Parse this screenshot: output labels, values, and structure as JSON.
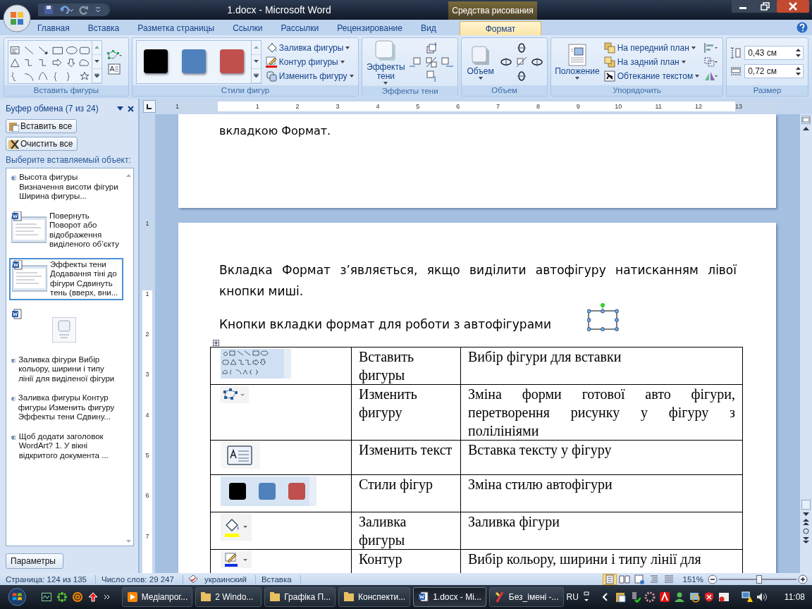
{
  "window": {
    "title": "1.docx - Microsoft Word",
    "context_tab": "Средства рисования"
  },
  "ribbon": {
    "tabs": [
      {
        "label": "Главная",
        "selected": false
      },
      {
        "label": "Вставка",
        "selected": false
      },
      {
        "label": "Разметка страницы",
        "selected": false
      },
      {
        "label": "Ссылки",
        "selected": false
      },
      {
        "label": "Рассылки",
        "selected": false
      },
      {
        "label": "Рецензирование",
        "selected": false
      },
      {
        "label": "Вид",
        "selected": false
      },
      {
        "label": "Формат",
        "selected": true
      }
    ],
    "groups": [
      {
        "kind": "shapes",
        "name": "Вставить фигуры"
      },
      {
        "kind": "styles",
        "name": "Стили фигур",
        "swatches": [
          {
            "color": "#000000"
          },
          {
            "color": "#4f81bd"
          },
          {
            "color": "#c0504d"
          }
        ],
        "commands": [
          "Заливка фигуры",
          "Контур фигуры",
          "Изменить фигуру"
        ]
      },
      {
        "kind": "shadow",
        "name": "Эффекты тени",
        "button": "Эффекты тени"
      },
      {
        "kind": "volume",
        "name": "Объем",
        "button": "Объем"
      },
      {
        "kind": "arrange",
        "name": "Упорядочить",
        "button": "Положение",
        "commands": [
          "На передний план",
          "На задний план",
          "Обтекание текстом"
        ]
      },
      {
        "kind": "size",
        "name": "Размер",
        "fields": [
          {
            "value": "0,43 см"
          },
          {
            "value": "0,72 см"
          }
        ]
      }
    ]
  },
  "clipboard_pane": {
    "title": "Буфер обмена (7 из 24)",
    "buttons": [
      "Вставить все",
      "Очистить все"
    ],
    "prompt": "Выберите вставляемый объект:",
    "items": [
      {
        "kind": "text",
        "text": "Высота фигуры Визначення висоти фігури Ширина фигуры...",
        "selected": false
      },
      {
        "kind": "thumbnail",
        "text": "Повернуть Поворот або відображення виділеного об’єкту",
        "selected": false
      },
      {
        "kind": "thumbnail",
        "text": "Эффекты тени Додавання тіні до фігури Сдвинуть тень (вверх, вни...",
        "selected": true
      },
      {
        "kind": "image",
        "selected": false
      },
      {
        "kind": "text",
        "text": "Заливка фігури Вибір кольору, ширини і типу лінії для виділеної фігури",
        "selected": false
      },
      {
        "kind": "text",
        "text": "Заливка фигуры Контур фигуры Изменить фигуру Эффекты тени Сдвину...",
        "selected": false
      },
      {
        "kind": "text",
        "text": "Щоб додати заголовок WordArt? 1. У вікні відкритого документа ...",
        "selected": false
      }
    ],
    "options_button": "Параметры"
  },
  "rulers": {
    "horizontal": [
      "1",
      "1",
      "2",
      "3",
      "4",
      "5",
      "6",
      "7",
      "8",
      "9",
      "10",
      "11",
      "12",
      "13"
    ],
    "vertical": [
      "1",
      "1",
      "2",
      "3",
      "4",
      "5",
      "6",
      "7"
    ]
  },
  "document": {
    "page_1": {
      "text": "вкладкою Формат."
    },
    "page_2": {
      "paragraphs": [
        "Вкладка Формат з’являється, якщо виділити автофігуру натисканням лівої кнопки миші.",
        "Кнопки вкладки формат для роботи з автофігурами"
      ],
      "table": {
        "rows": [
          {
            "kind": "shapes",
            "name": "Вставить фигуры",
            "description": "Вибір фігури для вставки"
          },
          {
            "kind": "edit_shape",
            "name": "Изменить фигуру",
            "description": "Зміна форми готової авто фігури, перетворення рисунку у фігуру з полілініями"
          },
          {
            "kind": "text_box",
            "name": "Изменить текст",
            "description": "Вставка тексту у фігуру"
          },
          {
            "kind": "styles",
            "name": "Стили фігур",
            "description": "Зміна стилю автофігури"
          },
          {
            "kind": "fill",
            "name": "Заливка фигуры",
            "description": "Заливка фігури"
          },
          {
            "kind": "outline",
            "name": "Контур",
            "description": "Вибір кольору, ширини і типу лінії для"
          }
        ]
      }
    }
  },
  "status_bar": {
    "items": [
      "Страница: 124 из 135",
      "Число слов: 29 247",
      "украинский",
      "Вставка"
    ],
    "views": [
      {
        "selected": true
      },
      {
        "selected": false
      },
      {
        "selected": false
      },
      {
        "selected": false
      },
      {
        "selected": false
      }
    ],
    "zoom": "151%",
    "zoom_slider": {
      "level": 0.52
    }
  },
  "taskbar": {
    "items": [
      {
        "label": "Медіапрог...",
        "selected": false
      },
      {
        "label": "2 Windo...",
        "selected": false
      },
      {
        "label": "Графіка П...",
        "selected": false
      },
      {
        "label": "Конспекти...",
        "selected": false
      },
      {
        "label": "1.docx - Mi...",
        "selected": true
      },
      {
        "label": "Без_імені -...",
        "selected": false
      }
    ],
    "language": "RU",
    "clock": "11:08"
  }
}
